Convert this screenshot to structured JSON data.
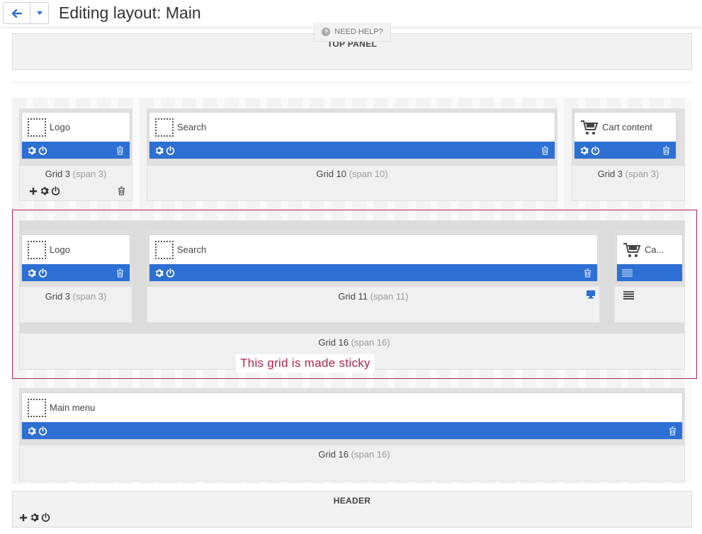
{
  "header": {
    "title": "Editing layout: Main",
    "help_label": "NEED HELP?"
  },
  "top_panel": {
    "title": "TOP PANEL"
  },
  "row1": {
    "grid_a": {
      "block": "Logo",
      "label": "Grid 3",
      "span": "(span 3)"
    },
    "grid_b": {
      "block": "Search",
      "label": "Grid 10",
      "span": "(span 10)"
    },
    "grid_c": {
      "block": "Cart content",
      "label": "Grid 3",
      "span": "(span 3)"
    }
  },
  "sticky": {
    "grid_a": {
      "block": "Logo",
      "label": "Grid 3",
      "span": "(span 3)"
    },
    "grid_b": {
      "block": "Search",
      "label": "Grid 11",
      "span": "(span 11)"
    },
    "grid_c": {
      "block": "Ca..."
    },
    "outer": {
      "label": "Grid 16",
      "span": "(span 16)"
    },
    "note": "This grid is made sticky"
  },
  "row3": {
    "grid": {
      "block": "Main menu",
      "label": "Grid 16",
      "span": "(span 16)"
    }
  },
  "header_panel": {
    "title": "HEADER"
  },
  "colors": {
    "accent": "#2d6fd3",
    "sticky": "#b3234a"
  },
  "icons": [
    "arrow-left-icon",
    "caret-down-icon",
    "question-icon",
    "placeholder-icon",
    "cart-icon",
    "gear-icon",
    "power-icon",
    "trash-icon",
    "plus-icon",
    "monitor-icon",
    "hamburger-icon"
  ]
}
